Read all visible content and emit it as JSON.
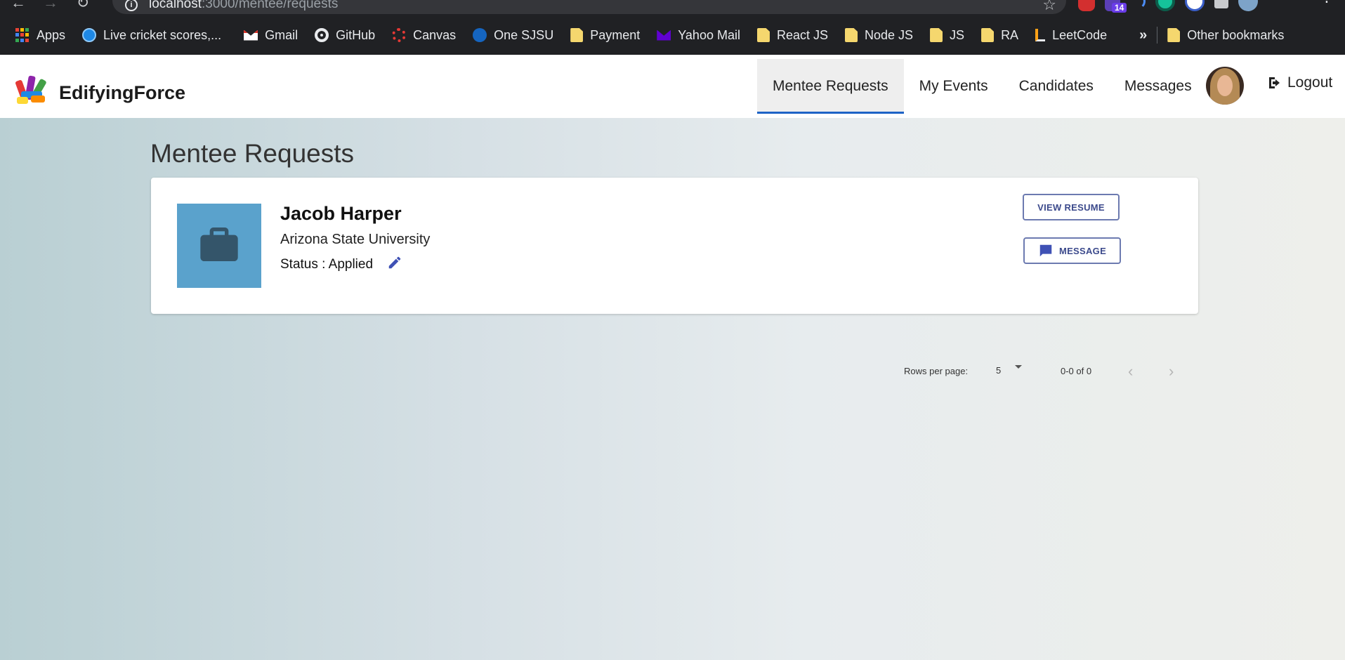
{
  "browser": {
    "url_host": "localhost",
    "url_path": ":3000/mentee/requests",
    "extension_badge": "14",
    "bookmarks": [
      {
        "label": "Apps",
        "icon": "apps-grid-icon"
      },
      {
        "label": "Live cricket scores,...",
        "icon": "globe-icon"
      },
      {
        "label": "Gmail",
        "icon": "gmail-icon"
      },
      {
        "label": "GitHub",
        "icon": "github-icon"
      },
      {
        "label": "Canvas",
        "icon": "canvas-icon"
      },
      {
        "label": "One SJSU",
        "icon": "sjsu-icon"
      },
      {
        "label": "Payment",
        "icon": "folder-icon"
      },
      {
        "label": "Yahoo Mail",
        "icon": "yahoo-mail-icon"
      },
      {
        "label": "React JS",
        "icon": "folder-icon"
      },
      {
        "label": "Node JS",
        "icon": "folder-icon"
      },
      {
        "label": "JS",
        "icon": "folder-icon"
      },
      {
        "label": "RA",
        "icon": "folder-icon"
      },
      {
        "label": "LeetCode",
        "icon": "leetcode-icon"
      }
    ],
    "overflow_label": "»",
    "other_bookmarks": "Other bookmarks"
  },
  "header": {
    "brand": "EdifyingForce",
    "nav": [
      {
        "label": "Mentee Requests",
        "active": true
      },
      {
        "label": "My Events",
        "active": false
      },
      {
        "label": "Candidates",
        "active": false
      },
      {
        "label": "Messages",
        "active": false
      }
    ],
    "logout": "Logout"
  },
  "main": {
    "title": "Mentee Requests",
    "requests": [
      {
        "name": "Jacob Harper",
        "school": "Arizona State University",
        "status": "Status : Applied",
        "view_resume": "VIEW RESUME",
        "message": "MESSAGE"
      }
    ],
    "pagination": {
      "rows_label": "Rows per page:",
      "rows_value": "5",
      "range": "0-0 of 0"
    }
  },
  "colors": {
    "accent": "#1e63c6",
    "button_text": "#3c4a8c",
    "thumb": "#5aa2cc"
  }
}
